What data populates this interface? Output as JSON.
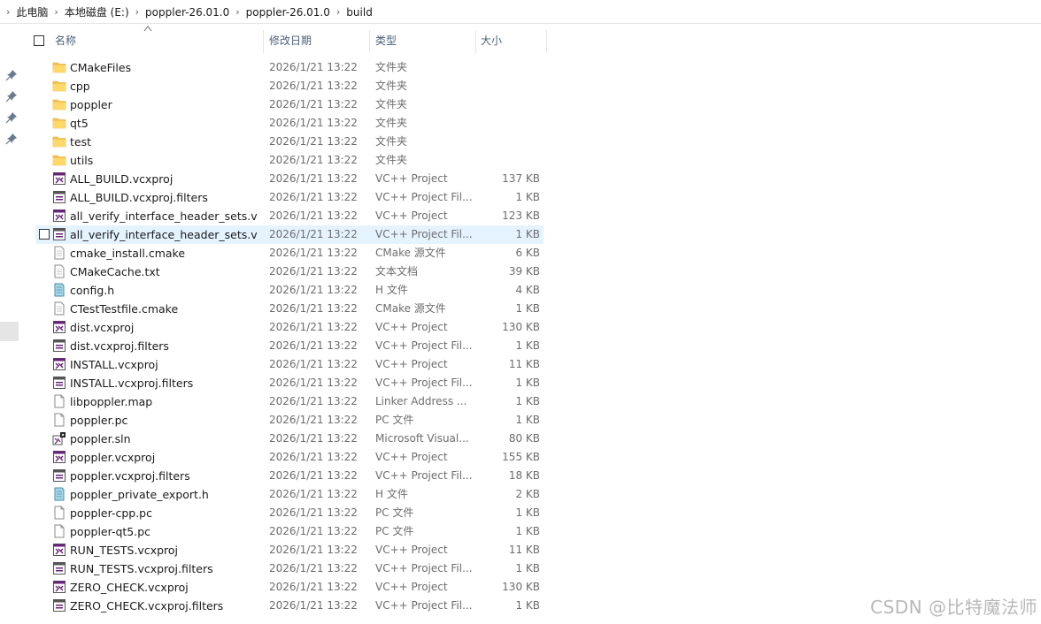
{
  "breadcrumb": [
    "此电脑",
    "本地磁盘 (E:)",
    "poppler-26.01.0",
    "poppler-26.01.0",
    "build"
  ],
  "columns": {
    "name": "名称",
    "date": "修改日期",
    "type": "类型",
    "size": "大小"
  },
  "colors": {
    "folder": "#f5c44e",
    "selection": "#e5f3ff",
    "header_text": "#4c607a"
  },
  "selected_index": 9,
  "files": [
    {
      "name": "CMakeFiles",
      "date": "2026/1/21 13:22",
      "type": "文件夹",
      "size": "",
      "icon": "folder-icon"
    },
    {
      "name": "cpp",
      "date": "2026/1/21 13:22",
      "type": "文件夹",
      "size": "",
      "icon": "folder-icon"
    },
    {
      "name": "poppler",
      "date": "2026/1/21 13:22",
      "type": "文件夹",
      "size": "",
      "icon": "folder-icon"
    },
    {
      "name": "qt5",
      "date": "2026/1/21 13:22",
      "type": "文件夹",
      "size": "",
      "icon": "folder-icon"
    },
    {
      "name": "test",
      "date": "2026/1/21 13:22",
      "type": "文件夹",
      "size": "",
      "icon": "folder-icon"
    },
    {
      "name": "utils",
      "date": "2026/1/21 13:22",
      "type": "文件夹",
      "size": "",
      "icon": "folder-icon"
    },
    {
      "name": "ALL_BUILD.vcxproj",
      "date": "2026/1/21 13:22",
      "type": "VC++ Project",
      "size": "137 KB",
      "icon": "vcxproj-icon"
    },
    {
      "name": "ALL_BUILD.vcxproj.filters",
      "date": "2026/1/21 13:22",
      "type": "VC++ Project Fil...",
      "size": "1 KB",
      "icon": "filters-icon"
    },
    {
      "name": "all_verify_interface_header_sets.vcx...",
      "date": "2026/1/21 13:22",
      "type": "VC++ Project",
      "size": "123 KB",
      "icon": "vcxproj-icon"
    },
    {
      "name": "all_verify_interface_header_sets.vcx...",
      "date": "2026/1/21 13:22",
      "type": "VC++ Project Fil...",
      "size": "1 KB",
      "icon": "filters-icon"
    },
    {
      "name": "cmake_install.cmake",
      "date": "2026/1/21 13:22",
      "type": "CMake 源文件",
      "size": "6 KB",
      "icon": "text-file-icon"
    },
    {
      "name": "CMakeCache.txt",
      "date": "2026/1/21 13:22",
      "type": "文本文档",
      "size": "39 KB",
      "icon": "text-file-icon"
    },
    {
      "name": "config.h",
      "date": "2026/1/21 13:22",
      "type": "H 文件",
      "size": "4 KB",
      "icon": "header-file-icon"
    },
    {
      "name": "CTestTestfile.cmake",
      "date": "2026/1/21 13:22",
      "type": "CMake 源文件",
      "size": "1 KB",
      "icon": "text-file-icon"
    },
    {
      "name": "dist.vcxproj",
      "date": "2026/1/21 13:22",
      "type": "VC++ Project",
      "size": "130 KB",
      "icon": "vcxproj-icon"
    },
    {
      "name": "dist.vcxproj.filters",
      "date": "2026/1/21 13:22",
      "type": "VC++ Project Fil...",
      "size": "1 KB",
      "icon": "filters-icon"
    },
    {
      "name": "INSTALL.vcxproj",
      "date": "2026/1/21 13:22",
      "type": "VC++ Project",
      "size": "11 KB",
      "icon": "vcxproj-icon"
    },
    {
      "name": "INSTALL.vcxproj.filters",
      "date": "2026/1/21 13:22",
      "type": "VC++ Project Fil...",
      "size": "1 KB",
      "icon": "filters-icon"
    },
    {
      "name": "libpoppler.map",
      "date": "2026/1/21 13:22",
      "type": "Linker Address ...",
      "size": "1 KB",
      "icon": "blank-file-icon"
    },
    {
      "name": "poppler.pc",
      "date": "2026/1/21 13:22",
      "type": "PC 文件",
      "size": "1 KB",
      "icon": "blank-file-icon"
    },
    {
      "name": "poppler.sln",
      "date": "2026/1/21 13:22",
      "type": "Microsoft Visual...",
      "size": "80 KB",
      "icon": "sln-icon"
    },
    {
      "name": "poppler.vcxproj",
      "date": "2026/1/21 13:22",
      "type": "VC++ Project",
      "size": "155 KB",
      "icon": "vcxproj-icon"
    },
    {
      "name": "poppler.vcxproj.filters",
      "date": "2026/1/21 13:22",
      "type": "VC++ Project Fil...",
      "size": "18 KB",
      "icon": "filters-icon"
    },
    {
      "name": "poppler_private_export.h",
      "date": "2026/1/21 13:22",
      "type": "H 文件",
      "size": "2 KB",
      "icon": "header-file-icon"
    },
    {
      "name": "poppler-cpp.pc",
      "date": "2026/1/21 13:22",
      "type": "PC 文件",
      "size": "1 KB",
      "icon": "blank-file-icon"
    },
    {
      "name": "poppler-qt5.pc",
      "date": "2026/1/21 13:22",
      "type": "PC 文件",
      "size": "1 KB",
      "icon": "blank-file-icon"
    },
    {
      "name": "RUN_TESTS.vcxproj",
      "date": "2026/1/21 13:22",
      "type": "VC++ Project",
      "size": "11 KB",
      "icon": "vcxproj-icon"
    },
    {
      "name": "RUN_TESTS.vcxproj.filters",
      "date": "2026/1/21 13:22",
      "type": "VC++ Project Fil...",
      "size": "1 KB",
      "icon": "filters-icon"
    },
    {
      "name": "ZERO_CHECK.vcxproj",
      "date": "2026/1/21 13:22",
      "type": "VC++ Project",
      "size": "130 KB",
      "icon": "vcxproj-icon"
    },
    {
      "name": "ZERO_CHECK.vcxproj.filters",
      "date": "2026/1/21 13:22",
      "type": "VC++ Project Fil...",
      "size": "1 KB",
      "icon": "filters-icon"
    }
  ],
  "watermark": "CSDN @比特魔法师"
}
